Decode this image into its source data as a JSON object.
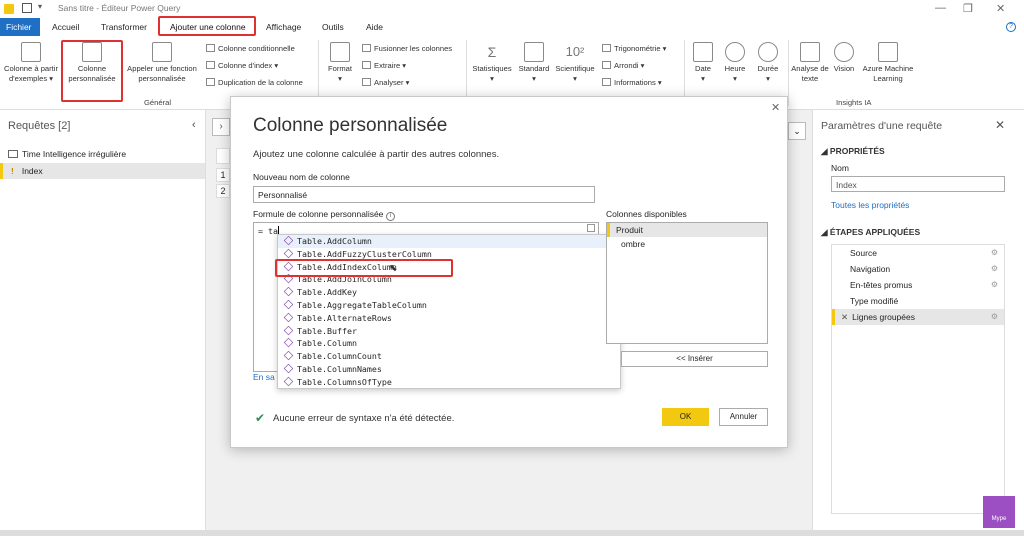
{
  "titlebar": {
    "title": "Sans titre - Éditeur Power Query"
  },
  "menu": {
    "fichier": "Fichier",
    "tabs": [
      "Accueil",
      "Transformer",
      "Ajouter une colonne",
      "Affichage",
      "Outils",
      "Aide"
    ]
  },
  "ribbon": {
    "col_examples": "Colonne à partir d'exemples ▾",
    "col_custom": "Colonne personnalisée",
    "invoke_fn": "Appeler une fonction personnalisée",
    "col_cond": "Colonne conditionnelle",
    "col_index": "Colonne d'index ▾",
    "dup_col": "Duplication de la colonne",
    "general": "Général",
    "format": "Format",
    "merge": "Fusionner les colonnes",
    "extract": "Extraire ▾",
    "analyze": "Analyser ▾",
    "stats": "Statistiques",
    "standard": "Standard",
    "scientific": "Scientifique",
    "trig": "Trigonométrie ▾",
    "round": "Arrondi ▾",
    "info": "Informations ▾",
    "date": "Date",
    "time": "Heure",
    "duration": "Durée",
    "text_analysis": "Analyse de texte",
    "vision": "Vision",
    "azure_ml": "Azure Machine Learning",
    "insights": "Insights IA"
  },
  "left": {
    "title": "Requêtes [2]",
    "items": [
      "Time Intelligence irrégulière",
      "Index"
    ]
  },
  "center": {
    "rows": [
      "1",
      "2"
    ]
  },
  "dialog": {
    "title": "Colonne personnalisée",
    "subtitle": "Ajoutez une colonne calculée à partir des autres colonnes.",
    "name_label": "Nouveau nom de colonne",
    "name_value": "Personnalisé",
    "formula_label": "Formule de colonne personnalisée",
    "formula_value": "= ta",
    "available_label": "Colonnes disponibles",
    "columns": [
      "Produit",
      "ombre"
    ],
    "insert": "<< Insérer",
    "learn_more": "En sa",
    "status": "Aucune erreur de syntaxe n'a été détectée.",
    "ok": "OK",
    "cancel": "Annuler",
    "autocomplete": [
      "Table.AddColumn",
      "Table.AddFuzzyClusterColumn",
      "Table.AddIndexColumn",
      "Table.AddJoinColumn",
      "Table.AddKey",
      "Table.AggregateTableColumn",
      "Table.AlternateRows",
      "Table.Buffer",
      "Table.Column",
      "Table.ColumnCount",
      "Table.ColumnNames",
      "Table.ColumnsOfType"
    ]
  },
  "right": {
    "title": "Paramètres d'une requête",
    "properties": "PROPRIÉTÉS",
    "name_label": "Nom",
    "name_value": "Index",
    "all_props": "Toutes les propriétés",
    "steps_title": "ÉTAPES APPLIQUÉES",
    "steps": [
      "Source",
      "Navigation",
      "En-têtes promus",
      "Type modifié",
      "Lignes groupées"
    ]
  },
  "watermark": "Mype",
  "colors": {
    "accent": "#1f6fc5",
    "highlight": "#e03131",
    "ok": "#f2c811"
  }
}
